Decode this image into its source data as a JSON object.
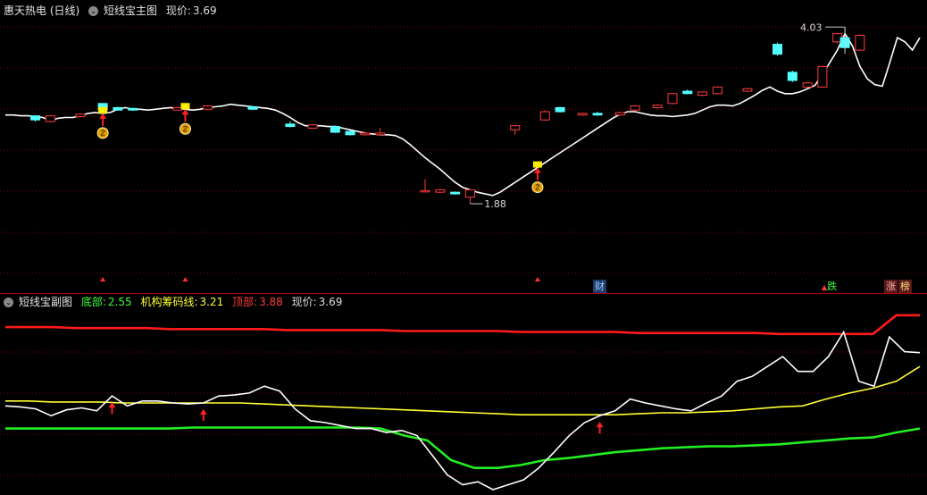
{
  "main_header": {
    "stock": "惠天热电 (日线)",
    "indicator": "短线宝主图",
    "price_label": "现价:",
    "price_value": "3.69"
  },
  "sub_header": {
    "indicator": "短线宝副图",
    "bottom_label": "底部:",
    "bottom_value": "2.55",
    "inst_label": "机构筹码线:",
    "inst_value": "3.21",
    "top_label": "顶部:",
    "top_value": "3.88",
    "price_label": "现价:",
    "price_value": "3.69"
  },
  "badges": {
    "cai": "财",
    "die": "跌",
    "zhang": "涨",
    "bang": "榜"
  },
  "colors": {
    "up": "#ff3b3b",
    "down": "#54ffff",
    "price_line": "#ffffff",
    "top_line": "#ff1a1a",
    "inst_line": "#ffff33",
    "bottom_line": "#22ee22",
    "grid": "#7a0000"
  },
  "chart_data": [
    {
      "type": "line",
      "title": "短线宝主图",
      "y_axis": "price",
      "annotations": [
        {
          "label": "4.03",
          "kind": "high"
        },
        {
          "label": "1.88",
          "kind": "low"
        }
      ],
      "series": [
        {
          "values": [
            2.96,
            2.96,
            2.95,
            2.95,
            2.94,
            2.93,
            2.89,
            2.92,
            2.93,
            2.93,
            2.95,
            2.98,
            2.99,
            2.98,
            2.99,
            3.03,
            3.05,
            3.03,
            3.03,
            3.02,
            3.03,
            3.04,
            3.05,
            3.04,
            3.03,
            3.02,
            3.03,
            3.05,
            3.06,
            3.07,
            3.09,
            3.08,
            3.07,
            3.06,
            3.05,
            3.04,
            3.02,
            2.98,
            2.93,
            2.87,
            2.83,
            2.83,
            2.83,
            2.82,
            2.82,
            2.8,
            2.78,
            2.76,
            2.74,
            2.73,
            2.72,
            2.72,
            2.71,
            2.67,
            2.6,
            2.52,
            2.44,
            2.37,
            2.3,
            2.22,
            2.14,
            2.08,
            2.05,
            2.02,
            2.0,
            1.98,
            2.02,
            2.08,
            2.14,
            2.2,
            2.26,
            2.32,
            2.38,
            2.44,
            2.5,
            2.56,
            2.62,
            2.68,
            2.74,
            2.8,
            2.86,
            2.92,
            2.97,
            3.0,
            3.0,
            2.98,
            2.96,
            2.95,
            2.95,
            2.94,
            2.95,
            2.96,
            2.98,
            3.02,
            3.06,
            3.08,
            3.08,
            3.07,
            3.1,
            3.15,
            3.2,
            3.26,
            3.3,
            3.25,
            3.22,
            3.22,
            3.24,
            3.28,
            3.32,
            3.45,
            3.6,
            3.75,
            3.95,
            3.8,
            3.55,
            3.4,
            3.33,
            3.31,
            3.6,
            3.9,
            3.85,
            3.75,
            3.9
          ]
        }
      ],
      "candles": [
        {
          "i": 4,
          "o": 2.95,
          "c": 2.9,
          "h": 2.96,
          "l": 2.88
        },
        {
          "i": 6,
          "o": 2.88,
          "c": 2.95,
          "h": 2.96,
          "l": 2.87
        },
        {
          "i": 10,
          "o": 2.94,
          "c": 2.97,
          "h": 2.98,
          "l": 2.93
        },
        {
          "i": 13,
          "o": 3.1,
          "c": 3.02,
          "h": 3.1,
          "l": 3.0
        },
        {
          "i": 15,
          "o": 3.05,
          "c": 3.02,
          "h": 3.06,
          "l": 3.01
        },
        {
          "i": 17,
          "o": 3.04,
          "c": 3.02,
          "h": 3.05,
          "l": 3.01
        },
        {
          "i": 23,
          "o": 3.02,
          "c": 3.05,
          "h": 3.06,
          "l": 3.01
        },
        {
          "i": 27,
          "o": 3.03,
          "c": 3.07,
          "h": 3.08,
          "l": 3.02
        },
        {
          "i": 33,
          "o": 3.06,
          "c": 3.03,
          "h": 3.07,
          "l": 3.02
        },
        {
          "i": 38,
          "o": 2.85,
          "c": 2.82,
          "h": 2.88,
          "l": 2.81
        },
        {
          "i": 41,
          "o": 2.8,
          "c": 2.84,
          "h": 2.85,
          "l": 2.79
        },
        {
          "i": 44,
          "o": 2.82,
          "c": 2.75,
          "h": 2.83,
          "l": 2.74
        },
        {
          "i": 46,
          "o": 2.76,
          "c": 2.72,
          "h": 2.77,
          "l": 2.71
        },
        {
          "i": 48,
          "o": 2.72,
          "c": 2.74,
          "h": 2.75,
          "l": 2.71
        },
        {
          "i": 50,
          "o": 2.72,
          "c": 2.74,
          "h": 2.8,
          "l": 2.71
        },
        {
          "i": 56,
          "o": 2.04,
          "c": 2.04,
          "h": 2.18,
          "l": 2.02
        },
        {
          "i": 58,
          "o": 2.02,
          "c": 2.05,
          "h": 2.06,
          "l": 2.01
        },
        {
          "i": 60,
          "o": 2.02,
          "c": 2.0,
          "h": 2.03,
          "l": 1.99
        },
        {
          "i": 62,
          "o": 1.96,
          "c": 2.05,
          "h": 2.06,
          "l": 1.88
        },
        {
          "i": 68,
          "o": 2.78,
          "c": 2.83,
          "h": 2.84,
          "l": 2.72
        },
        {
          "i": 72,
          "o": 2.9,
          "c": 3.0,
          "h": 3.02,
          "l": 2.89
        },
        {
          "i": 74,
          "o": 3.05,
          "c": 3.0,
          "h": 3.06,
          "l": 2.99
        },
        {
          "i": 77,
          "o": 2.96,
          "c": 2.98,
          "h": 2.99,
          "l": 2.95
        },
        {
          "i": 79,
          "o": 2.98,
          "c": 2.96,
          "h": 3.0,
          "l": 2.95
        },
        {
          "i": 82,
          "o": 2.96,
          "c": 2.99,
          "h": 3.0,
          "l": 2.95
        },
        {
          "i": 84,
          "o": 3.02,
          "c": 3.07,
          "h": 3.08,
          "l": 3.01
        },
        {
          "i": 87,
          "o": 3.05,
          "c": 3.08,
          "h": 3.09,
          "l": 3.04
        },
        {
          "i": 89,
          "o": 3.1,
          "c": 3.22,
          "h": 3.23,
          "l": 3.09
        },
        {
          "i": 91,
          "o": 3.25,
          "c": 3.22,
          "h": 3.27,
          "l": 3.21
        },
        {
          "i": 93,
          "o": 3.2,
          "c": 3.24,
          "h": 3.25,
          "l": 3.19
        },
        {
          "i": 95,
          "o": 3.22,
          "c": 3.3,
          "h": 3.31,
          "l": 3.21
        },
        {
          "i": 99,
          "o": 3.25,
          "c": 3.28,
          "h": 3.29,
          "l": 3.24
        },
        {
          "i": 103,
          "o": 3.82,
          "c": 3.7,
          "h": 3.84,
          "l": 3.68
        },
        {
          "i": 105,
          "o": 3.48,
          "c": 3.38,
          "h": 3.5,
          "l": 3.36
        },
        {
          "i": 107,
          "o": 3.3,
          "c": 3.35,
          "h": 3.36,
          "l": 3.29
        },
        {
          "i": 109,
          "o": 3.3,
          "c": 3.55,
          "h": 3.56,
          "l": 3.29
        },
        {
          "i": 111,
          "o": 3.85,
          "c": 3.95,
          "h": 3.96,
          "l": 3.83
        },
        {
          "i": 112,
          "o": 3.9,
          "c": 3.78,
          "h": 4.03,
          "l": 3.76
        },
        {
          "i": 114,
          "o": 3.75,
          "c": 3.93,
          "h": 3.94,
          "l": 3.74
        }
      ],
      "ylim": [
        1.75,
        4.12
      ]
    },
    {
      "type": "line",
      "title": "短线宝副图",
      "y_axis": "price",
      "series": [
        {
          "name": "顶部",
          "values": [
            3.95,
            3.95,
            3.95,
            3.94,
            3.94,
            3.94,
            3.94,
            3.93,
            3.93,
            3.93,
            3.93,
            3.93,
            3.92,
            3.92,
            3.92,
            3.92,
            3.92,
            3.91,
            3.91,
            3.91,
            3.91,
            3.91,
            3.9,
            3.9,
            3.9,
            3.9,
            3.9,
            3.89,
            3.89,
            3.89,
            3.89,
            3.89,
            3.89,
            3.88,
            3.88,
            3.88,
            3.88,
            3.88,
            4.07,
            4.07
          ]
        },
        {
          "name": "机构筹码线",
          "values": [
            3.2,
            3.2,
            3.19,
            3.19,
            3.19,
            3.18,
            3.18,
            3.18,
            3.18,
            3.18,
            3.18,
            3.17,
            3.16,
            3.15,
            3.14,
            3.13,
            3.12,
            3.11,
            3.1,
            3.09,
            3.08,
            3.07,
            3.06,
            3.06,
            3.06,
            3.06,
            3.06,
            3.07,
            3.08,
            3.08,
            3.09,
            3.1,
            3.12,
            3.14,
            3.15,
            3.22,
            3.28,
            3.33,
            3.4,
            3.55
          ]
        },
        {
          "name": "底部",
          "values": [
            2.92,
            2.92,
            2.92,
            2.92,
            2.92,
            2.92,
            2.92,
            2.92,
            2.93,
            2.93,
            2.93,
            2.93,
            2.93,
            2.93,
            2.93,
            2.93,
            2.92,
            2.85,
            2.8,
            2.6,
            2.52,
            2.52,
            2.55,
            2.6,
            2.62,
            2.65,
            2.68,
            2.7,
            2.72,
            2.73,
            2.74,
            2.74,
            2.75,
            2.76,
            2.78,
            2.8,
            2.82,
            2.83,
            2.88,
            2.92
          ]
        },
        {
          "name": "现价",
          "values": [
            3.15,
            3.14,
            3.12,
            3.05,
            3.11,
            3.13,
            3.1,
            3.25,
            3.15,
            3.2,
            3.2,
            3.18,
            3.17,
            3.18,
            3.25,
            3.26,
            3.28,
            3.35,
            3.3,
            3.12,
            3.0,
            2.98,
            2.95,
            2.92,
            2.92,
            2.88,
            2.9,
            2.85,
            2.65,
            2.45,
            2.35,
            2.38,
            2.3,
            2.35,
            2.4,
            2.52,
            2.68,
            2.85,
            2.98,
            3.05,
            3.1,
            3.22,
            3.18,
            3.15,
            3.12,
            3.1,
            3.18,
            3.25,
            3.4,
            3.45,
            3.55,
            3.65,
            3.5,
            3.5,
            3.65,
            3.9,
            3.4,
            3.35,
            3.85,
            3.7,
            3.69
          ]
        }
      ],
      "ylim": [
        2.3,
        4.15
      ]
    }
  ]
}
